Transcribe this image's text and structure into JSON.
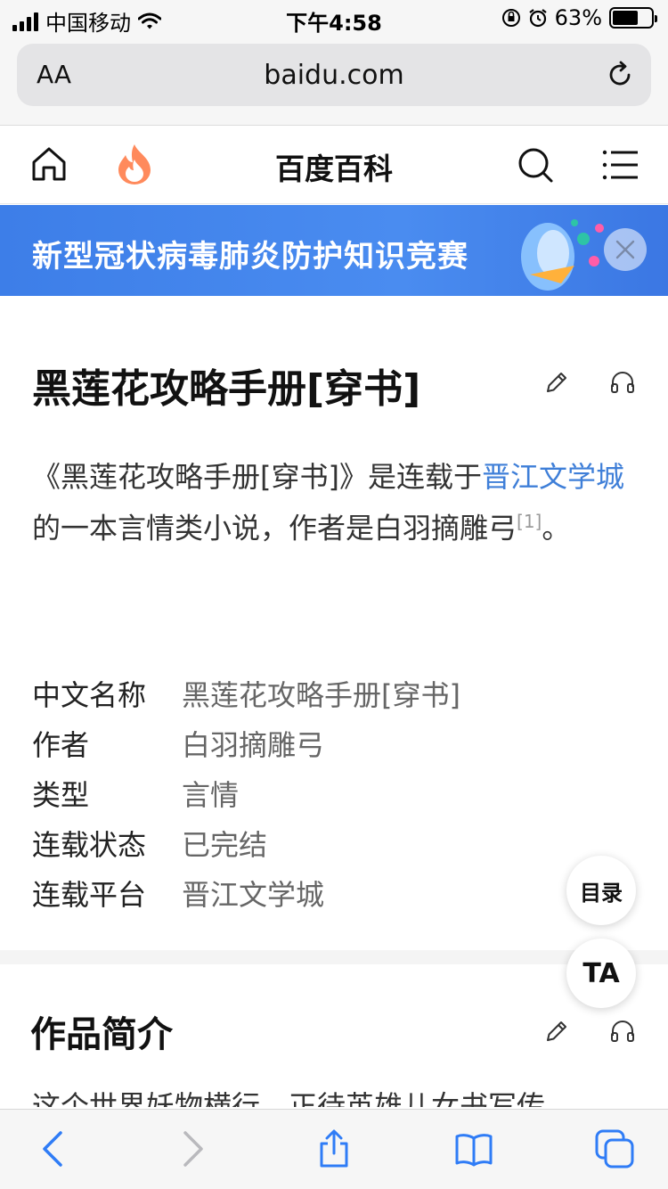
{
  "status_bar": {
    "carrier": "中国移动",
    "time": "下午4:58",
    "battery": "63%"
  },
  "browser": {
    "text_size_label": "AA",
    "url": "baidu.com"
  },
  "site_header": {
    "title": "百度百科"
  },
  "banner": {
    "text": "新型冠状病毒肺炎防护知识竞赛"
  },
  "article": {
    "title": "黑莲花攻略手册[穿书]",
    "intro": {
      "part1": "《黑莲花攻略手册[穿书]》是连载于",
      "link": "晋江文学城",
      "part2": "的一本言情类小说，作者是白羽摘雕弓",
      "ref": "[1]",
      "part3": "。"
    },
    "info": [
      {
        "key": "中文名称",
        "value": "黑莲花攻略手册[穿书]"
      },
      {
        "key": "作者",
        "value": "白羽摘雕弓"
      },
      {
        "key": "类型",
        "value": "言情"
      },
      {
        "key": "连载状态",
        "value": "已完结"
      },
      {
        "key": "连载平台",
        "value": "晋江文学城"
      }
    ]
  },
  "floating": {
    "toc_label": "目录",
    "ta_label": "TA"
  },
  "section": {
    "title": "作品简介",
    "preview": "这个世界妖物横行，正待英雄儿女书写传"
  }
}
